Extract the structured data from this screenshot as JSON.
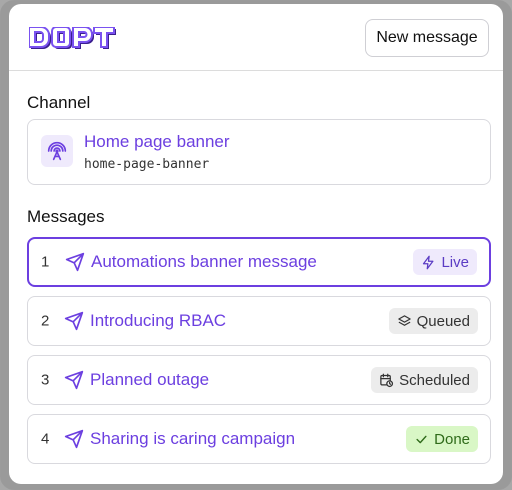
{
  "header": {
    "logo_text": "DOPT",
    "new_message_label": "New message"
  },
  "channel": {
    "section_label": "Channel",
    "title": "Home page banner",
    "slug": "home-page-banner",
    "icon": "broadcast-icon"
  },
  "messages": {
    "section_label": "Messages",
    "items": [
      {
        "num": "1",
        "title": "Automations banner message",
        "status": "Live",
        "status_icon": "bolt-icon",
        "active": true
      },
      {
        "num": "2",
        "title": "Introducing RBAC",
        "status": "Queued",
        "status_icon": "layers-icon",
        "active": false
      },
      {
        "num": "3",
        "title": "Planned outage",
        "status": "Scheduled",
        "status_icon": "calendar-clock-icon",
        "active": false
      },
      {
        "num": "4",
        "title": "Sharing is caring campaign",
        "status": "Done",
        "status_icon": "check-icon",
        "active": false
      }
    ]
  },
  "colors": {
    "accent": "#6c3fe0",
    "live_bg": "#efeafc",
    "done_bg": "#d9f7c6",
    "neutral_badge_bg": "#ececec"
  }
}
